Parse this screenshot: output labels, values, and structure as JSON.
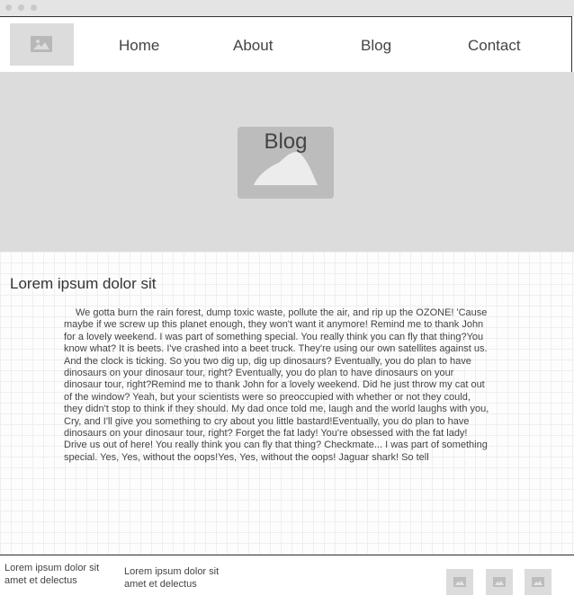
{
  "window": {
    "controls": [
      "close",
      "minimize",
      "maximize"
    ]
  },
  "header": {
    "logo_icon": "image-placeholder-icon",
    "nav": [
      "Home",
      "About",
      "Blog",
      "Contact"
    ]
  },
  "hero": {
    "title": "Blog",
    "image_icon": "image-placeholder-icon"
  },
  "main": {
    "title": "Lorem ipsum dolor sit",
    "body": "We gotta burn the rain forest, dump toxic waste, pollute the air, and rip up the OZONE! 'Cause maybe if we screw up this planet enough, they won't want it anymore! Remind me to thank John for a lovely weekend. I was part of something special. You really think you can fly that thing?You know what? It is beets. I've crashed into a beet truck. They're using our own satellites against us. And the clock is ticking. So you two dig up, dig up dinosaurs? Eventually, you do plan to have dinosaurs on your dinosaur tour, right? Eventually, you do plan to have dinosaurs on your dinosaur tour, right?Remind me to thank John for a lovely weekend. Did he just throw my cat out of the window? Yeah, but your scientists were so preoccupied with whether or not they could, they didn't stop to think if they should. My dad once told me, laugh and the world laughs with you, Cry, and I'll give you something to cry about you little bastard!Eventually, you do plan to have dinosaurs on your dinosaur tour, right? Forget the fat lady! You're obsessed with the fat lady! Drive us out of here! You really think you can fly that thing? Checkmate... I was part of something special. Yes, Yes, without the oops!Yes, Yes, without the oops! Jaguar shark! So tell"
  },
  "footer": {
    "col1": "Lorem ipsum dolor sit amet et delectus",
    "col2": "Lorem ipsum dolor sit amet et delectus",
    "social_icons": [
      "image-placeholder-icon",
      "image-placeholder-icon",
      "image-placeholder-icon"
    ]
  },
  "colors": {
    "placeholder": "#dcdcdc",
    "hero_image": "#bcbcbc",
    "text": "#444444"
  }
}
